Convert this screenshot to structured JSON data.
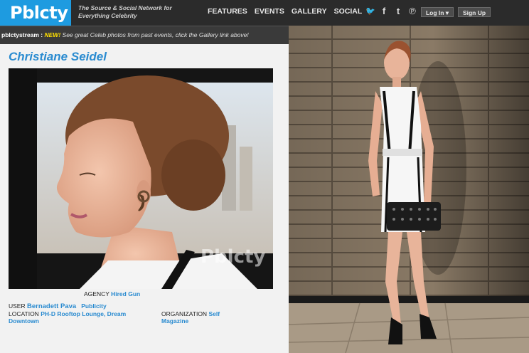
{
  "header": {
    "logo": "Pblcty",
    "tagline": "The Source & Social Network for Everything Celebrity",
    "nav": [
      "FEATURES",
      "EVENTS",
      "GALLERY",
      "SOCIAL"
    ],
    "social_icons": [
      "twitter-icon",
      "facebook-icon",
      "tumblr-icon",
      "pinterest-icon"
    ],
    "social_glyphs": [
      "🐦",
      "f",
      "t",
      "℗"
    ],
    "login_label": "Log In ▾",
    "signup_label": "Sign Up"
  },
  "stream": {
    "label": "pblctystream :",
    "new_tag": "NEW!",
    "message": "See great Celeb photos from past events, click the Gallery link above!"
  },
  "profile": {
    "name": "Christiane Seidel",
    "watermark": "Pblcty",
    "agency_label": "AGENCY",
    "agency_value": "Hired Gun",
    "user_label": "USER",
    "user_value": "Bernadett Pava",
    "user_org": "Publicity",
    "location_label": "LOCATION",
    "location_value": "PH-D Rooftop Lounge, Dream Downtown",
    "organization_label": "ORGANIZATION",
    "organization_value": "Self Magazine"
  },
  "colors": {
    "accent": "#2a8bd0",
    "logo_bg": "#1e9be0",
    "header_bg": "#2b2b2b",
    "new_tag": "#ffe000"
  }
}
